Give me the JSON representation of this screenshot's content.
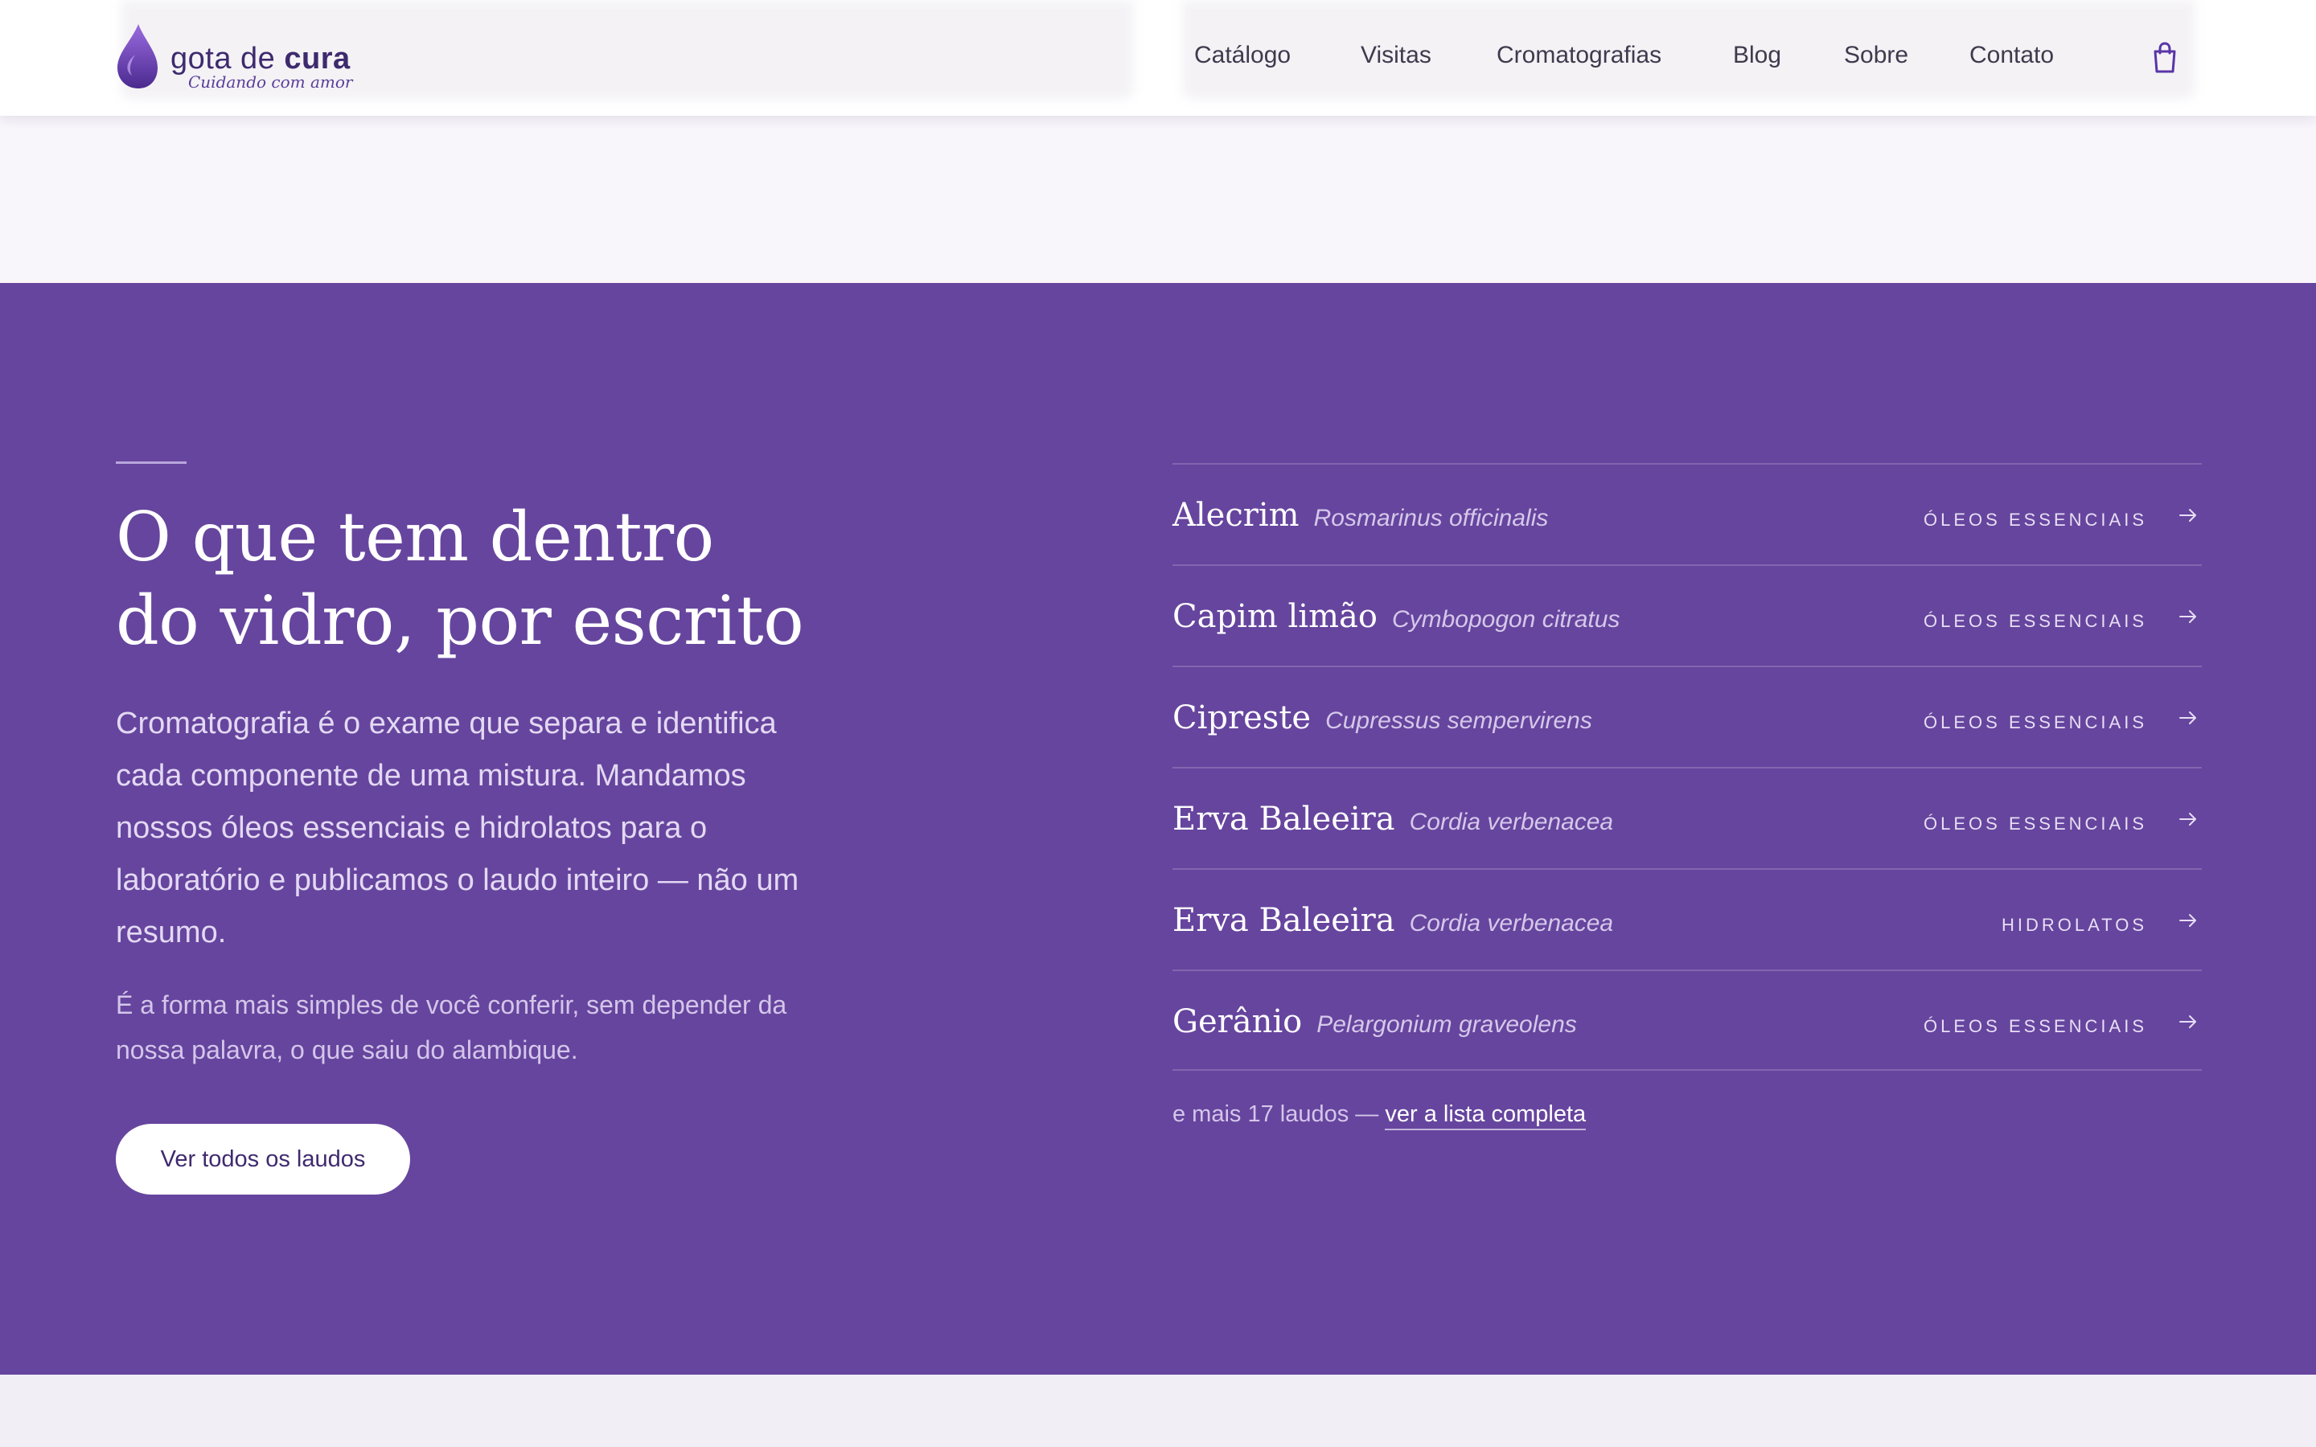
{
  "header": {
    "brand_light": "gota de ",
    "brand_bold": "cura",
    "tagline": "Cuidando com amor",
    "nav": [
      "Catálogo",
      "Visitas",
      "Cromatografias",
      "Blog",
      "Sobre",
      "Contato"
    ],
    "cart_icon": "shopping-bag-icon"
  },
  "colors": {
    "brand_purple": "#66459e",
    "page_background": "#f8f6fb",
    "header_background": "#ffffff"
  },
  "intro": {
    "headline_line1": "O que tem dentro",
    "headline_line2": "do vidro, por escrito",
    "lead": "Cromatografia é o exame que separa e identifica cada componente de uma mistura. Mandamos nossos óleos essenciais e hidrolatos para o laboratório e publicamos o laudo inteiro — não um resumo.",
    "sub": "É a forma mais simples de você conferir, sem depender da nossa palavra, o que saiu do alambique.",
    "button_label": "Ver todos os laudos"
  },
  "reports": [
    {
      "name": "Alecrim",
      "scientific": "Rosmarinus officinalis",
      "category": "ÓLEOS ESSENCIAIS"
    },
    {
      "name": "Capim limão",
      "scientific": "Cymbopogon citratus",
      "category": "ÓLEOS ESSENCIAIS"
    },
    {
      "name": "Cipreste",
      "scientific": "Cupressus sempervirens",
      "category": "ÓLEOS ESSENCIAIS"
    },
    {
      "name": "Erva Baleeira",
      "scientific": "Cordia verbenacea",
      "category": "ÓLEOS ESSENCIAIS"
    },
    {
      "name": "Erva Baleeira",
      "scientific": "Cordia verbenacea",
      "category": "HIDROLATOS"
    },
    {
      "name": "Gerânio",
      "scientific": "Pelargonium graveolens",
      "category": "ÓLEOS ESSENCIAIS"
    }
  ],
  "more": {
    "prefix": "e mais 17 laudos — ",
    "link_label": "ver a lista completa"
  }
}
